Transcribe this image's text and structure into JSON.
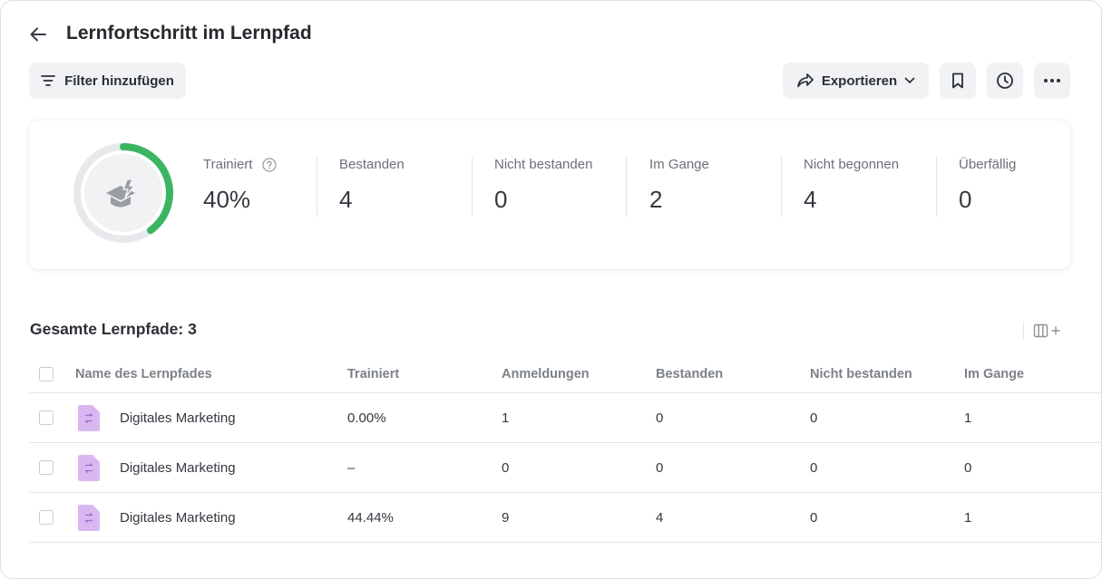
{
  "header": {
    "title": "Lernfortschritt im Lernpfad",
    "filter_label": "Filter hinzufügen",
    "export_label": "Exportieren"
  },
  "stats": {
    "progress_fraction": 0.4,
    "colors": {
      "progress": "#3cb563",
      "track": "#e8e9ec",
      "icon": "#9a9da3"
    },
    "items": [
      {
        "label": "Trainiert",
        "value": "40%"
      },
      {
        "label": "Bestanden",
        "value": "4"
      },
      {
        "label": "Nicht bestanden",
        "value": "0"
      },
      {
        "label": "Im Gange",
        "value": "2"
      },
      {
        "label": "Nicht begonnen",
        "value": "4"
      },
      {
        "label": "Überfällig",
        "value": "0"
      }
    ]
  },
  "table": {
    "title": "Gesamte Lernpfade: 3",
    "columns": [
      "Name des Lernpfades",
      "Trainiert",
      "Anmeldungen",
      "Bestanden",
      "Nicht bestanden",
      "Im Gange"
    ],
    "rows": [
      {
        "name": "Digitales Marketing",
        "trained": "0.00%",
        "enrollments": "1",
        "passed": "0",
        "failed": "0",
        "in_progress": "1"
      },
      {
        "name": "Digitales Marketing",
        "trained": "–",
        "enrollments": "0",
        "passed": "0",
        "failed": "0",
        "in_progress": "0"
      },
      {
        "name": "Digitales Marketing",
        "trained": "44.44%",
        "enrollments": "9",
        "passed": "4",
        "failed": "0",
        "in_progress": "1"
      }
    ],
    "file_icon_color": "#d9b8f2"
  }
}
